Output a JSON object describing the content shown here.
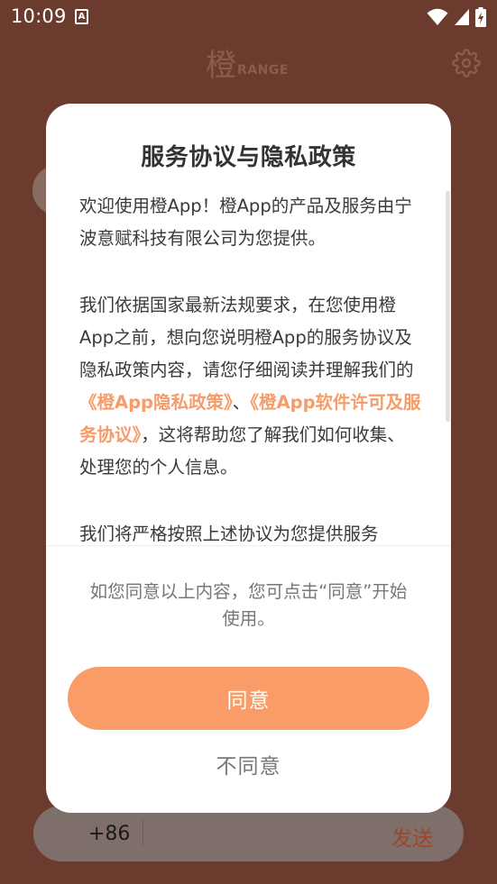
{
  "status_bar": {
    "time": "10:09",
    "notification_icon_letter": "A",
    "icons": [
      "wifi-icon",
      "signal-icon",
      "battery-charging-icon"
    ]
  },
  "app": {
    "logo_char": "橙",
    "logo_word": "RANGE",
    "settings_icon": "gear-icon"
  },
  "phone_input": {
    "country_code": "+86",
    "send_label": "发送"
  },
  "dialog": {
    "title": "服务协议与隐私政策",
    "paragraph1": "欢迎使用橙App！橙App的产品及服务由宁波意赋科技有限公司为您提供。",
    "paragraph2_before": "我们依据国家最新法规要求，在您使用橙App之前，想向您说明橙App的服务协议及隐私政策内容，请您仔细阅读并理解我们的",
    "privacy_link": "《橙App隐私政策》",
    "separator": "、",
    "service_link": "《橙App软件许可及服务协议》",
    "paragraph2_after": "，这将帮助您了解我们如何收集、处理您的个人信息。",
    "paragraph3": "我们将严格按照上述协议为您提供服务",
    "consent_note": "如您同意以上内容，您可点击“同意”开始使用。",
    "agree_label": "同意",
    "disagree_label": "不同意"
  },
  "colors": {
    "background": "#6b3c2e",
    "accent": "#f99c68",
    "link": "#f59c6a",
    "send": "#a0442c"
  }
}
